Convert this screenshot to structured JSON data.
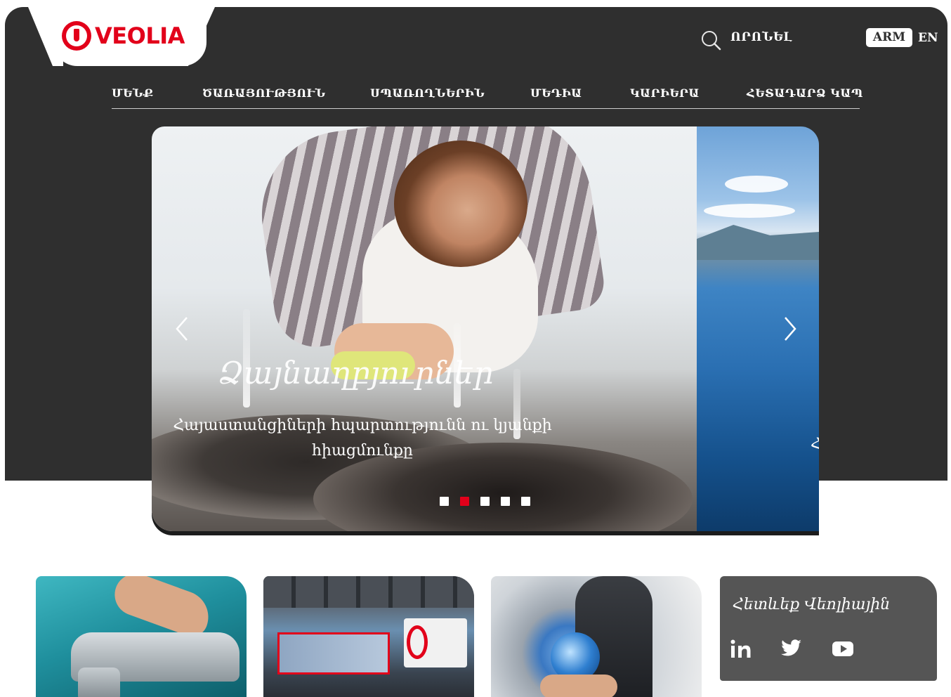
{
  "brand": {
    "name": "VEOLIA",
    "color": "#e2001a"
  },
  "header": {
    "search_label": "ՈՐՈՆԵԼ",
    "languages": {
      "active": "ARM",
      "other": "EN"
    }
  },
  "nav": {
    "items": [
      {
        "label": "ՄԵՆՔ"
      },
      {
        "label": "ԾԱՌԱՅՈՒԹՅՈՒՆ"
      },
      {
        "label": "ՍՊԱՌՈՂՆԵՐԻՆ"
      },
      {
        "label": "ՄԵԴԻԱ"
      },
      {
        "label": "ԿԱՐԻԵՐԱ"
      },
      {
        "label": "ՀԵՏԱԴԱՐՁ ԿԱՊ"
      }
    ]
  },
  "slider": {
    "title": "Ձայնաղբյուրներ",
    "text": "Հայաստանցիների հպարտությունն ու կյանքի հիացմունքը",
    "side_caption": "Հ",
    "slide_count": 5,
    "active_slide": 2
  },
  "follow": {
    "title": "Հետևեք Վեոլիային",
    "icons": [
      "linkedin-icon",
      "twitter-icon",
      "youtube-icon"
    ]
  },
  "colors": {
    "header_bg": "#2f2f2f",
    "accent": "#e2001a",
    "follow_bg": "#555555"
  }
}
